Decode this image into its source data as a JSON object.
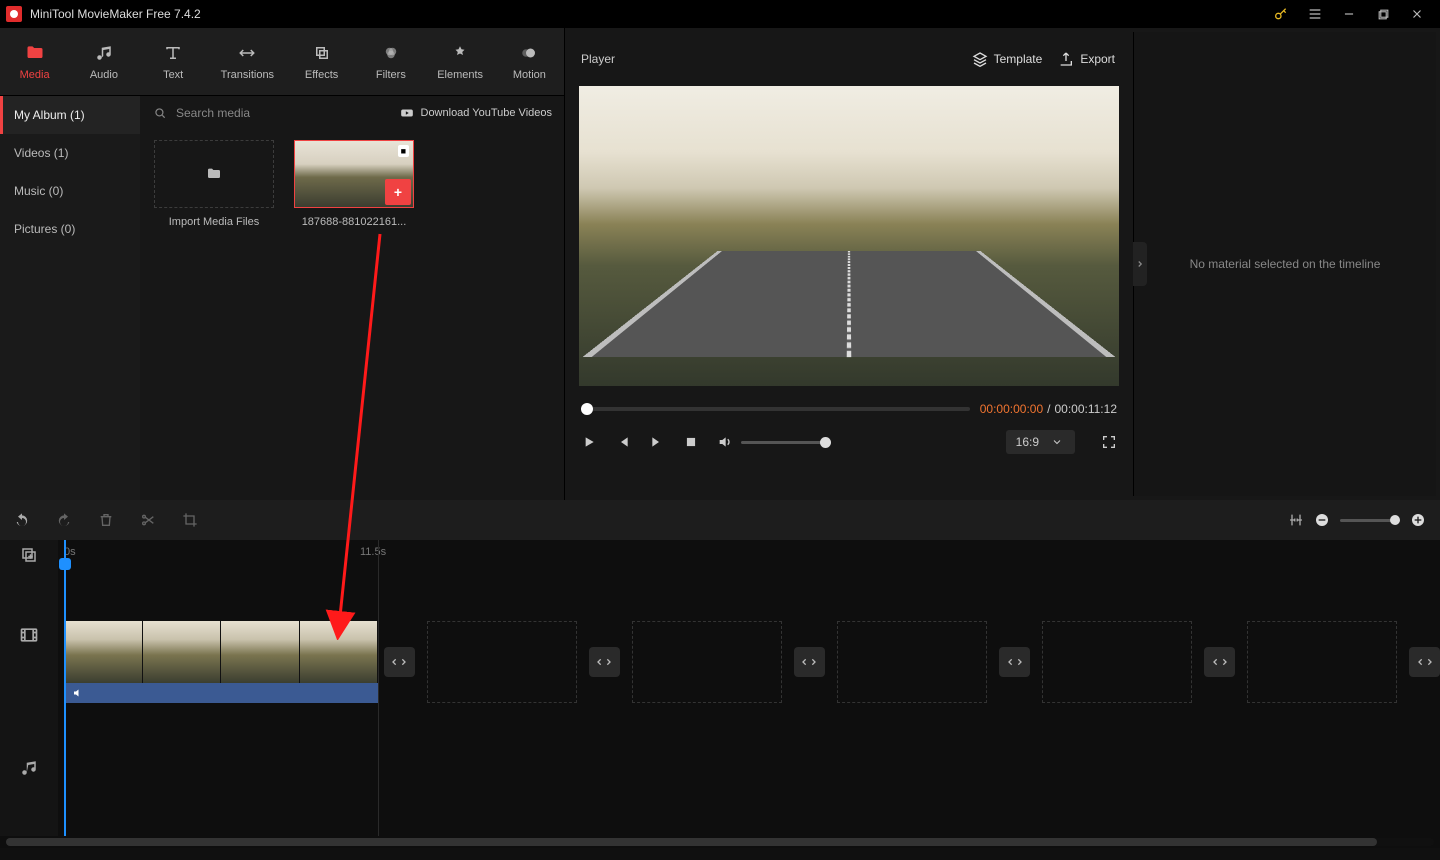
{
  "app": {
    "title": "MiniTool MovieMaker Free 7.4.2"
  },
  "ribbon": [
    {
      "label": "Media",
      "active": true
    },
    {
      "label": "Audio",
      "active": false
    },
    {
      "label": "Text",
      "active": false
    },
    {
      "label": "Transitions",
      "active": false
    },
    {
      "label": "Effects",
      "active": false
    },
    {
      "label": "Filters",
      "active": false
    },
    {
      "label": "Elements",
      "active": false
    },
    {
      "label": "Motion",
      "active": false
    }
  ],
  "sidebar": [
    {
      "label": "My Album (1)",
      "active": true
    },
    {
      "label": "Videos (1)",
      "active": false
    },
    {
      "label": "Music (0)",
      "active": false
    },
    {
      "label": "Pictures (0)",
      "active": false
    }
  ],
  "mediabar": {
    "search_placeholder": "Search media",
    "download_label": "Download YouTube Videos"
  },
  "mediacards": {
    "import_label": "Import Media Files",
    "clip_label": "187688-881022161..."
  },
  "player": {
    "label": "Player",
    "template_label": "Template",
    "export_label": "Export",
    "time_current": "00:00:00:00",
    "time_sep": " / ",
    "time_total": "00:00:11:12",
    "ratio": "16:9"
  },
  "inspector": {
    "empty_text": "No material selected on the timeline"
  },
  "timeline": {
    "ruler_start": "0s",
    "ruler_mark": "11.5s"
  }
}
